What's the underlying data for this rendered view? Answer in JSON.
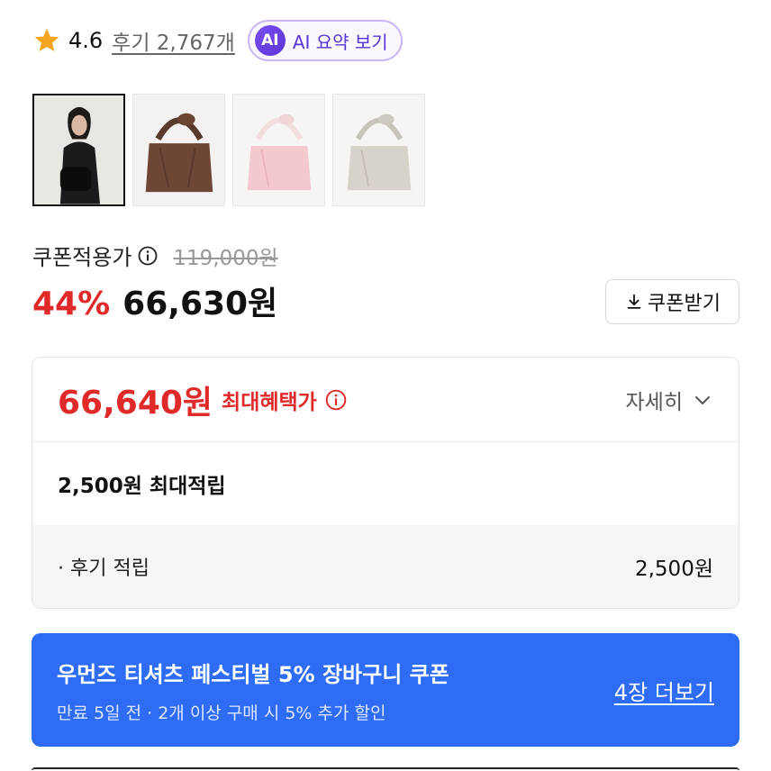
{
  "rating": {
    "icon": "star-icon",
    "value": "4.6",
    "reviews_link": "후기 2,767개"
  },
  "ai_summary": {
    "badge": "AI",
    "label": "AI 요약 보기"
  },
  "thumbnails": [
    {
      "alt": "model-with-black-bag",
      "selected": true
    },
    {
      "alt": "brown-bag",
      "selected": false
    },
    {
      "alt": "pink-bag",
      "selected": false
    },
    {
      "alt": "beige-bag",
      "selected": false
    }
  ],
  "pricing": {
    "coupon_price_label": "쿠폰적용가",
    "original_price": "119,000원",
    "discount_rate": "44%",
    "final_price": "66,630원",
    "coupon_button": "쿠폰받기"
  },
  "benefit": {
    "max_price": "66,640원",
    "max_label": "최대혜택가",
    "details_toggle": "자세히",
    "points_text": "2,500원 최대적립",
    "review_points_label": "· 후기 적립",
    "review_points_value": "2,500원"
  },
  "promo": {
    "title": "우먼즈 티셔츠 페스티벌 5% 장바구니 쿠폰",
    "subtitle": "만료 5일 전 · 2개 이상 구매 시 5% 추가 할인",
    "more_link": "4장 더보기"
  },
  "colors": {
    "accent_red": "#e02a2a",
    "promo_blue": "#2f6cf6",
    "ai_purple": "#5b34d6"
  }
}
